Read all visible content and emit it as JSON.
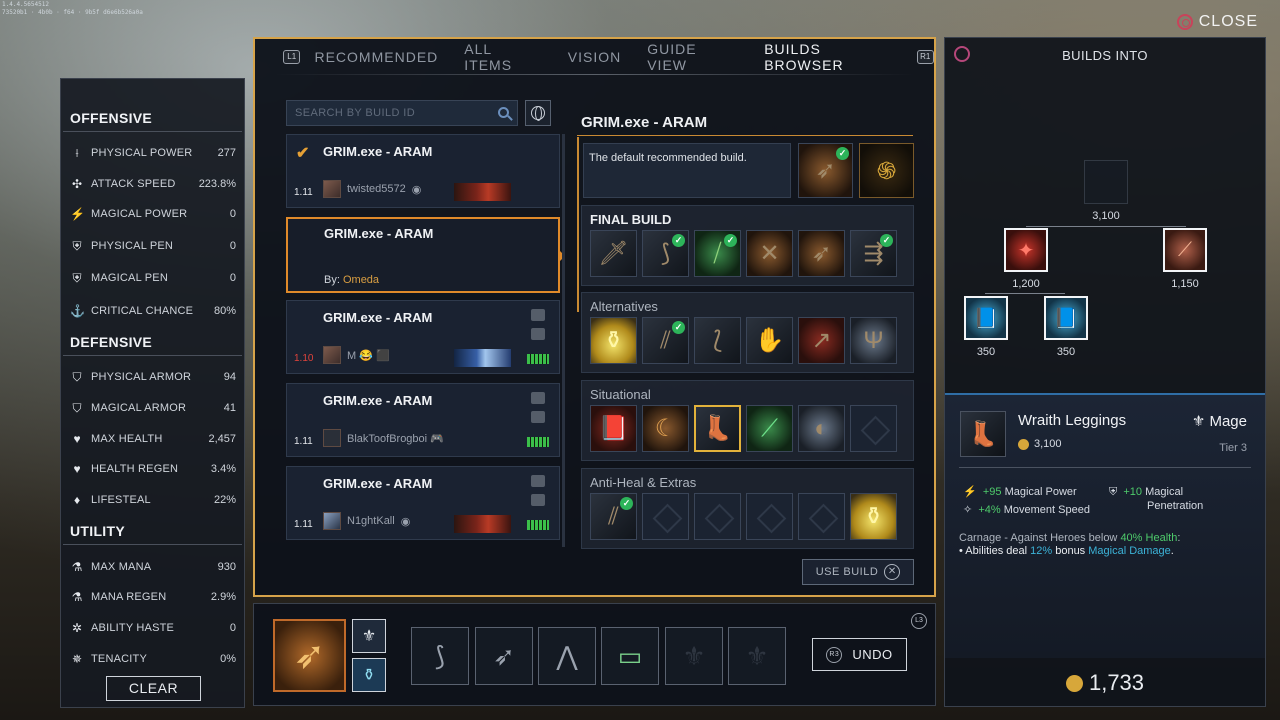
{
  "debug_text": "1.4.4.5654512\n73520b1 · 4b0b · f64 · 9b5f d6e6b526a0a",
  "close_label": "CLOSE",
  "stats": {
    "offensive_title": "OFFENSIVE",
    "defensive_title": "DEFENSIVE",
    "utility_title": "UTILITY",
    "offensive": [
      {
        "icon": "⟊",
        "name": "PHYSICAL POWER",
        "value": "277"
      },
      {
        "icon": "✣",
        "name": "ATTACK SPEED",
        "value": "223.8%"
      },
      {
        "icon": "⚡",
        "name": "MAGICAL POWER",
        "value": "0"
      },
      {
        "icon": "⛨",
        "name": "PHYSICAL PEN",
        "value": "0"
      },
      {
        "icon": "⛨",
        "name": "MAGICAL PEN",
        "value": "0"
      },
      {
        "icon": "⚓",
        "name": "CRITICAL CHANCE",
        "value": "80%"
      }
    ],
    "defensive": [
      {
        "icon": "⛉",
        "name": "PHYSICAL ARMOR",
        "value": "94"
      },
      {
        "icon": "⛉",
        "name": "MAGICAL ARMOR",
        "value": "41"
      },
      {
        "icon": "♥",
        "name": "MAX HEALTH",
        "value": "2,457"
      },
      {
        "icon": "♥",
        "name": "HEALTH REGEN",
        "value": "3.4%"
      },
      {
        "icon": "♦",
        "name": "LIFESTEAL",
        "value": "22%"
      }
    ],
    "utility": [
      {
        "icon": "⚗",
        "name": "MAX MANA",
        "value": "930"
      },
      {
        "icon": "⚗",
        "name": "MANA REGEN",
        "value": "2.9%"
      },
      {
        "icon": "✲",
        "name": "ABILITY HASTE",
        "value": "0"
      },
      {
        "icon": "✵",
        "name": "TENACITY",
        "value": "0%"
      }
    ],
    "clear_label": "CLEAR"
  },
  "tabs": {
    "left_key": "L1",
    "right_key": "R1",
    "items": [
      "RECOMMENDED",
      "ALL ITEMS",
      "VISION",
      "GUIDE VIEW",
      "BUILDS BROWSER"
    ],
    "active": "BUILDS BROWSER"
  },
  "search": {
    "placeholder": "SEARCH BY BUILD ID"
  },
  "builds": [
    {
      "name": "GRIM.exe - ARAM",
      "version": "1.11",
      "author": "twisted5572",
      "checked": true
    },
    {
      "name": "GRIM.exe - ARAM",
      "by_prefix": "By:",
      "by_name": "Omeda",
      "selected": true
    },
    {
      "name": "GRIM.exe - ARAM",
      "version": "1.10",
      "author": "M 😂 ⬛"
    },
    {
      "name": "GRIM.exe - ARAM",
      "version": "1.11",
      "author": "BlakToofBrogboi 🎮"
    },
    {
      "name": "GRIM.exe - ARAM",
      "version": "1.11",
      "author": "N1ghtKall"
    }
  ],
  "detail": {
    "title": "GRIM.exe - ARAM",
    "description": "The default recommended build.",
    "sections": [
      {
        "title": "FINAL BUILD",
        "bold": true
      },
      {
        "title": "Alternatives"
      },
      {
        "title": "Situational"
      },
      {
        "title": "Anti-Heal & Extras"
      }
    ],
    "use_build_label": "USE BUILD"
  },
  "bottom": {
    "undo_label": "UNDO",
    "undo_key": "R3",
    "l3_key": "L3"
  },
  "right_panel": {
    "header": "BUILDS INTO",
    "tree": {
      "top_cost": "3,100",
      "left_cost": "1,200",
      "right_cost": "1,150",
      "book1_cost": "350",
      "book2_cost": "350"
    },
    "item": {
      "name": "Wraith Leggings",
      "class": "Mage",
      "cost": "3,100",
      "tier": "Tier 3",
      "stat1_value": "+95",
      "stat1_name": "Magical Power",
      "stat2_value": "+10",
      "stat2_name": "Magical",
      "stat2_name_2": "Penetration",
      "stat3_value": "+4%",
      "stat3_name": "Movement Speed",
      "passive_name": "Carnage",
      "passive_cond_1": " - Against Heroes below ",
      "passive_cond_hl": "40% Health",
      "passive_cond_2": ":",
      "passive_line_1": "• Abilities deal ",
      "passive_pct": "12%",
      "passive_line_2": " bonus ",
      "passive_dmg": "Magical Damage",
      "passive_end": "."
    },
    "gold": "1,733"
  },
  "colors": {
    "gold_border": "#d6a34a",
    "selected_border": "#e08a2a",
    "check_green": "#2db45a",
    "stat_green": "#4ecb6b",
    "magic_blue": "#3cb3d8"
  }
}
